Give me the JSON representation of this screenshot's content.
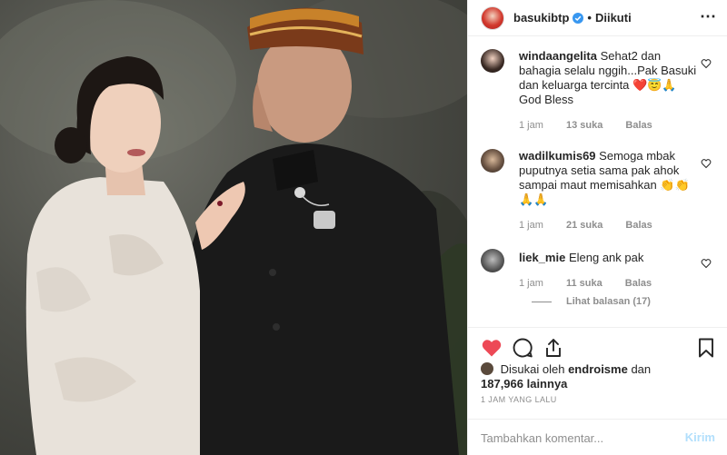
{
  "post": {
    "photo_alt": "Foto pasangan berpakaian tradisional",
    "author": "basukibtp",
    "separator": "•",
    "follow_state": "Diikuti",
    "more_icon": "more-options-icon"
  },
  "comments": [
    {
      "user": "windaangelita",
      "text": "Sehat2 dan bahagia selalu nggih...Pak Basuki dan keluarga tercinta ❤️😇🙏 God Bless",
      "time": "1 jam",
      "likes": "13 suka",
      "reply": "Balas"
    },
    {
      "user": "wadilkumis69",
      "text": "Semoga mbak puputnya setia sama pak ahok sampai maut memisahkan 👏👏🙏🙏",
      "time": "1 jam",
      "likes": "21 suka",
      "reply": "Balas"
    },
    {
      "user": "liek_mie",
      "text": "Eleng ank pak",
      "time": "1 jam",
      "likes": "11 suka",
      "reply": "Balas",
      "view_replies": "Lihat balasan (17)"
    }
  ],
  "engagement": {
    "liked_by_prefix": "Disukai oleh",
    "liked_by_user": "endroisme",
    "liked_by_joiner": "dan",
    "others_count": "187,966 lainnya",
    "timestamp": "1 JAM YANG LALU"
  },
  "composer": {
    "placeholder": "Tambahkan komentar...",
    "post_label": "Kirim"
  },
  "colors": {
    "like_red": "#ed4956",
    "verified_blue": "#3897f0",
    "post_disabled": "#b2dffc",
    "muted": "#8e8e8e"
  }
}
